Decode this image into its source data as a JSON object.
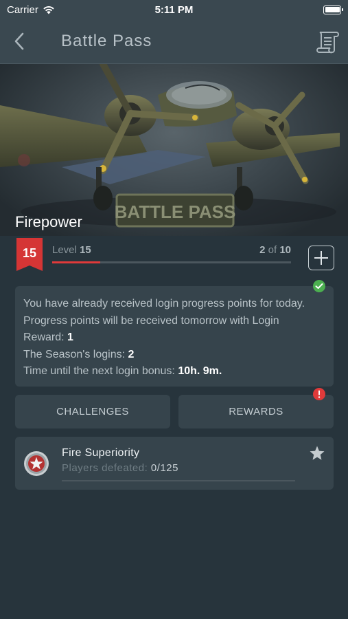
{
  "status_bar": {
    "carrier": "Carrier",
    "time": "5:11 PM",
    "icons": [
      "wifi-icon",
      "battery-icon"
    ]
  },
  "nav": {
    "title": "Battle Pass",
    "back_icon": "chevron-left-icon",
    "right_icon": "scroll-icon"
  },
  "hero": {
    "title": "Firepower",
    "banner_text": "BATTLE PASS"
  },
  "level": {
    "label": "Level",
    "number": "15",
    "progress_current": "2",
    "progress_sep": "of",
    "progress_total": "10",
    "progress_fraction": 0.2,
    "add_icon": "plus-icon"
  },
  "info": {
    "line1": "You have already received login progress points for today.",
    "line2": "Progress points will be received tomorrow with Login",
    "line3_label": "Reward: ",
    "line3_value": "1",
    "line4_label": "The Season's logins: ",
    "line4_value": "2",
    "line5_label": "Time until the next login bonus: ",
    "line5_value": "10h. 9m.",
    "status_icon": "check-circle-icon"
  },
  "tabs": {
    "challenges": "CHALLENGES",
    "rewards": "REWARDS",
    "rewards_alert_icon": "exclamation-circle-icon"
  },
  "challenge": {
    "name": "Fire Superiority",
    "metric_label": "Players defeated:",
    "metric_value": "0/125",
    "progress_fraction": 0,
    "emblem_icon": "star-emblem-icon",
    "favorite_icon": "star-icon"
  },
  "colors": {
    "accent_red": "#e03a3a",
    "success_green": "#4caf50",
    "card_bg": "#36444c",
    "page_bg": "#27343c"
  }
}
